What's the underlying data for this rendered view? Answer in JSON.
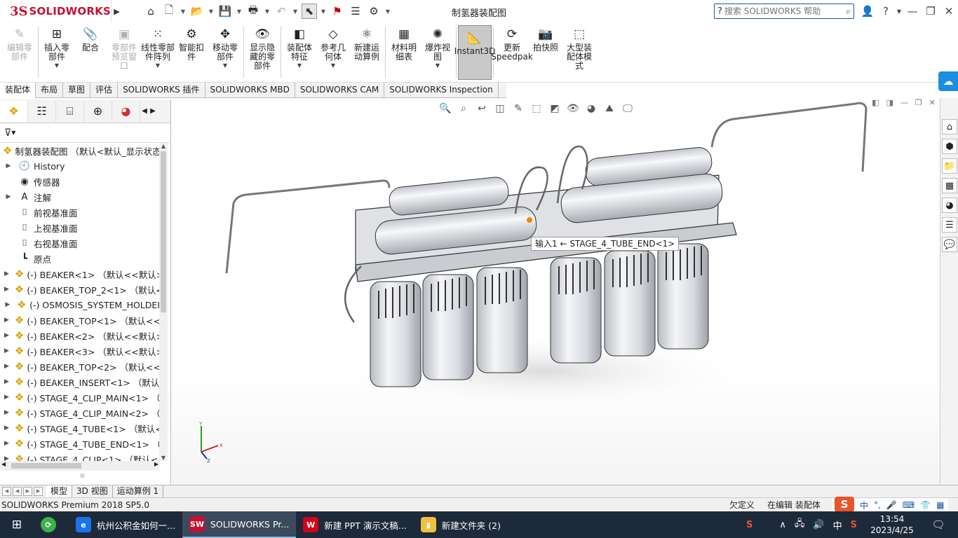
{
  "app": {
    "logo_ds": "3S",
    "logo_name": "SOLIDWORKS",
    "title": "制氢器装配图",
    "search_placeholder": "搜索 SOLIDWORKS 帮助"
  },
  "ribbon": [
    {
      "label": "编辑零\n部件",
      "icon": "✎",
      "disabled": true,
      "dropdown": false,
      "name": "edit-component"
    },
    {
      "label": "插入零\n部件",
      "icon": "⊞",
      "disabled": false,
      "dropdown": true,
      "name": "insert-components"
    },
    {
      "label": "配合",
      "icon": "📎",
      "disabled": false,
      "dropdown": false,
      "name": "mate"
    },
    {
      "label": "零部件\n预览窗\n口",
      "icon": "▣",
      "disabled": true,
      "dropdown": false,
      "name": "component-preview"
    },
    {
      "label": "线性零部\n件阵列",
      "icon": "⁙",
      "disabled": false,
      "dropdown": true,
      "name": "linear-pattern"
    },
    {
      "label": "智能扣\n件",
      "icon": "⚙",
      "disabled": false,
      "dropdown": false,
      "name": "smart-fasteners"
    },
    {
      "label": "移动零\n部件",
      "icon": "✥",
      "disabled": false,
      "dropdown": true,
      "name": "move-component"
    },
    {
      "label": "显示隐\n藏的零\n部件",
      "icon": "👁",
      "disabled": false,
      "dropdown": false,
      "name": "show-hidden"
    },
    {
      "label": "装配体\n特征",
      "icon": "◧",
      "disabled": false,
      "dropdown": true,
      "name": "assembly-features"
    },
    {
      "label": "参考几\n何体",
      "icon": "◇",
      "disabled": false,
      "dropdown": true,
      "name": "reference-geometry"
    },
    {
      "label": "新建运\n动算例",
      "icon": "⚛",
      "disabled": false,
      "dropdown": false,
      "name": "new-motion-study"
    },
    {
      "label": "材料明\n细表",
      "icon": "▦",
      "disabled": false,
      "dropdown": false,
      "name": "bill-of-materials"
    },
    {
      "label": "爆炸视\n图",
      "icon": "✺",
      "disabled": false,
      "dropdown": true,
      "name": "exploded-view"
    },
    {
      "label": "Instant3D",
      "icon": "📐",
      "disabled": false,
      "dropdown": false,
      "active": true,
      "name": "instant3d"
    },
    {
      "label": "更新\nSpeedpak",
      "icon": "⟳",
      "disabled": false,
      "dropdown": false,
      "name": "update-speedpak"
    },
    {
      "label": "拍快照",
      "icon": "📷",
      "disabled": false,
      "dropdown": false,
      "name": "take-snapshot"
    },
    {
      "label": "大型装\n配体模\n式",
      "icon": "⬚",
      "disabled": false,
      "dropdown": false,
      "name": "large-assembly-mode"
    }
  ],
  "command_tabs": [
    "装配体",
    "布局",
    "草图",
    "评估",
    "SOLIDWORKS 插件",
    "SOLIDWORKS MBD",
    "SOLIDWORKS CAM",
    "SOLIDWORKS Inspection"
  ],
  "tree": {
    "root": "制氢器装配图 （默认<默认_显示状态-",
    "items": [
      {
        "label": "History",
        "icon": "🕘",
        "exp": "▶",
        "part": false
      },
      {
        "label": "传感器",
        "icon": "◉",
        "exp": "",
        "part": false
      },
      {
        "label": "注解",
        "icon": "A",
        "exp": "▶",
        "part": false
      },
      {
        "label": "前视基准面",
        "icon": "⌷",
        "exp": "",
        "part": false
      },
      {
        "label": "上视基准面",
        "icon": "⌷",
        "exp": "",
        "part": false
      },
      {
        "label": "右视基准面",
        "icon": "⌷",
        "exp": "",
        "part": false
      },
      {
        "label": "原点",
        "icon": "┗",
        "exp": "",
        "part": false
      },
      {
        "label": "(-) BEAKER<1> （默认<<默认>_",
        "icon": "❖",
        "exp": "▶",
        "part": true
      },
      {
        "label": "(-) BEAKER_TOP_2<1> （默认<<",
        "icon": "❖",
        "exp": "▶",
        "part": true
      },
      {
        "label": "(-) OSMOSIS_SYSTEM_HOLDEI",
        "icon": "❖",
        "exp": "▶",
        "part": true
      },
      {
        "label": "(-) BEAKER_TOP<1> （默认<<默",
        "icon": "❖",
        "exp": "▶",
        "part": true
      },
      {
        "label": "(-) BEAKER<2> （默认<<默认>_",
        "icon": "❖",
        "exp": "▶",
        "part": true
      },
      {
        "label": "(-) BEAKER<3> （默认<<默认>_",
        "icon": "❖",
        "exp": "▶",
        "part": true
      },
      {
        "label": "(-) BEAKER_TOP<2> （默认<<默",
        "icon": "❖",
        "exp": "▶",
        "part": true
      },
      {
        "label": "(-) BEAKER_INSERT<1> （默认<",
        "icon": "❖",
        "exp": "▶",
        "part": true
      },
      {
        "label": "(-) STAGE_4_CLIP_MAIN<1> （默",
        "icon": "❖",
        "exp": "▶",
        "part": true
      },
      {
        "label": "(-) STAGE_4_CLIP_MAIN<2> （默",
        "icon": "❖",
        "exp": "▶",
        "part": true
      },
      {
        "label": "(-) STAGE_4_TUBE<1> （默认<<",
        "icon": "❖",
        "exp": "▶",
        "part": true
      },
      {
        "label": "(-) STAGE_4_TUBE_END<1> （默",
        "icon": "❖",
        "exp": "▶",
        "part": true
      },
      {
        "label": "(-) STAGE_4_CLIP<1> （默认<<",
        "icon": "❖",
        "exp": "▶",
        "part": true
      }
    ]
  },
  "viewport": {
    "tooltip": "输入1 ← STAGE_4_TUBE_END<1>"
  },
  "model_tabs": [
    "模型",
    "3D 视图",
    "运动算例 1"
  ],
  "status": {
    "product": "SOLIDWORKS Premium 2018 SP5.0",
    "definition": "欠定义",
    "mode": "在编辑 装配体"
  },
  "ime": {
    "zh": "中",
    "punct": "°,"
  },
  "taskbar": {
    "items": [
      {
        "label": "杭州公积金如何一...",
        "color": "#1a73e8",
        "icon": "e"
      },
      {
        "label": "SOLIDWORKS Pr...",
        "color": "#c8102e",
        "icon": "SW",
        "active": true
      },
      {
        "label": "新建 PPT 演示文稿...",
        "color": "#d0021b",
        "icon": "W"
      },
      {
        "label": "新建文件夹 (2)",
        "color": "#f0c040",
        "icon": "▮"
      }
    ],
    "ime_zh": "中",
    "time": "13:54",
    "date": "2023/4/25"
  }
}
